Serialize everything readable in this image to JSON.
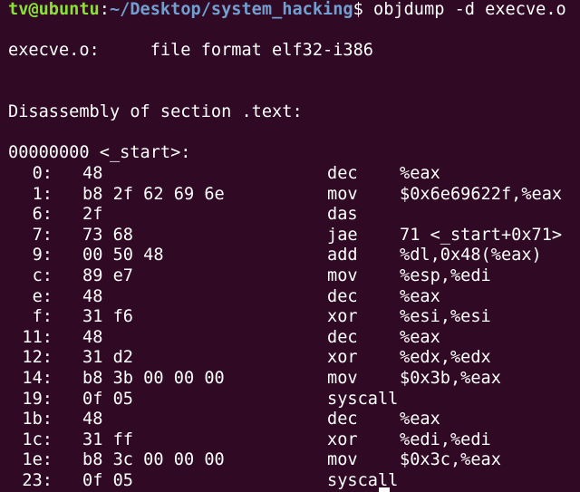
{
  "prompt": {
    "user_host": "tv@ubuntu",
    "separator": ":",
    "path": "~/Desktop/system_hacking",
    "symbol": "$",
    "command": " objdump -d execve.o"
  },
  "header": {
    "file_line": "execve.o:     file format elf32-i386",
    "section_line": "Disassembly of section .text:",
    "symbol_line": "00000000 <_start>:"
  },
  "rows": [
    {
      "offset": "0:",
      "bytes": "48",
      "mnemonic": "dec",
      "operands": "%eax"
    },
    {
      "offset": "1:",
      "bytes": "b8 2f 62 69 6e",
      "mnemonic": "mov",
      "operands": "$0x6e69622f,%eax"
    },
    {
      "offset": "6:",
      "bytes": "2f",
      "mnemonic": "das",
      "operands": ""
    },
    {
      "offset": "7:",
      "bytes": "73 68",
      "mnemonic": "jae",
      "operands": "71 <_start+0x71>"
    },
    {
      "offset": "9:",
      "bytes": "00 50 48",
      "mnemonic": "add",
      "operands": "%dl,0x48(%eax)"
    },
    {
      "offset": "c:",
      "bytes": "89 e7",
      "mnemonic": "mov",
      "operands": "%esp,%edi"
    },
    {
      "offset": "e:",
      "bytes": "48",
      "mnemonic": "dec",
      "operands": "%eax"
    },
    {
      "offset": "f:",
      "bytes": "31 f6",
      "mnemonic": "xor",
      "operands": "%esi,%esi"
    },
    {
      "offset": "11:",
      "bytes": "48",
      "mnemonic": "dec",
      "operands": "%eax"
    },
    {
      "offset": "12:",
      "bytes": "31 d2",
      "mnemonic": "xor",
      "operands": "%edx,%edx"
    },
    {
      "offset": "14:",
      "bytes": "b8 3b 00 00 00",
      "mnemonic": "mov",
      "operands": "$0x3b,%eax"
    },
    {
      "offset": "19:",
      "bytes": "0f 05",
      "mnemonic": "syscall",
      "operands": ""
    },
    {
      "offset": "1b:",
      "bytes": "48",
      "mnemonic": "dec",
      "operands": "%eax"
    },
    {
      "offset": "1c:",
      "bytes": "31 ff",
      "mnemonic": "xor",
      "operands": "%edi,%edi"
    },
    {
      "offset": "1e:",
      "bytes": "b8 3c 00 00 00",
      "mnemonic": "mov",
      "operands": "$0x3c,%eax"
    },
    {
      "offset": "23:",
      "bytes": "0f 05",
      "mnemonic": "syscall",
      "operands": ""
    }
  ],
  "colors": {
    "background": "#300a24",
    "text": "#ffffff",
    "user_host": "#8ae234",
    "path": "#729fcf"
  }
}
